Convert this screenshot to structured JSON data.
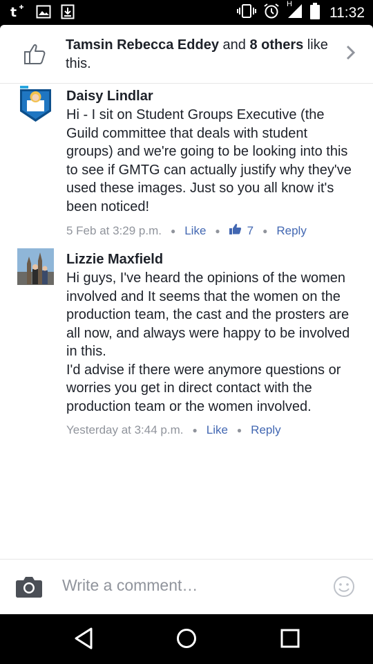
{
  "status_bar": {
    "time": "11:32",
    "network_label": "H",
    "left_icons": [
      "tumblr-notification-icon",
      "image-notification-icon",
      "download-notification-icon"
    ],
    "right_icons": [
      "vibrate-icon",
      "alarm-icon",
      "signal-icon",
      "battery-icon"
    ]
  },
  "likes": {
    "first_name": "Tamsin Rebecca Eddey",
    "and_text": " and ",
    "others": "8 others",
    "suffix": " like this."
  },
  "comments": [
    {
      "author": "Daisy Lindlar",
      "text": "Hi - I sit on Student Groups Executive (the Guild committee that deals with student groups) and we're going to be looking into this to see if GMTG can actually justify why they've used these images. Just so you all know it's been noticed!",
      "timestamp": "5 Feb at 3:29 p.m.",
      "like_label": "Like",
      "like_count": "7",
      "reply_label": "Reply"
    },
    {
      "author": "Lizzie Maxfield",
      "text_lines": [
        "Hi guys, I've heard the opinions of the women involved and It seems that  the women on the production team, the cast and the prosters are all now, and always were happy to be involved in this.",
        "I'd advise if there were anymore questions or worries you get in direct contact with the production team or the women involved."
      ],
      "timestamp": "Yesterday at 3:44 p.m.",
      "like_label": "Like",
      "reply_label": "Reply"
    }
  ],
  "composer": {
    "placeholder": "Write a comment…"
  },
  "colors": {
    "link": "#4267b2",
    "meta": "#90949c",
    "text": "#1d2129"
  }
}
